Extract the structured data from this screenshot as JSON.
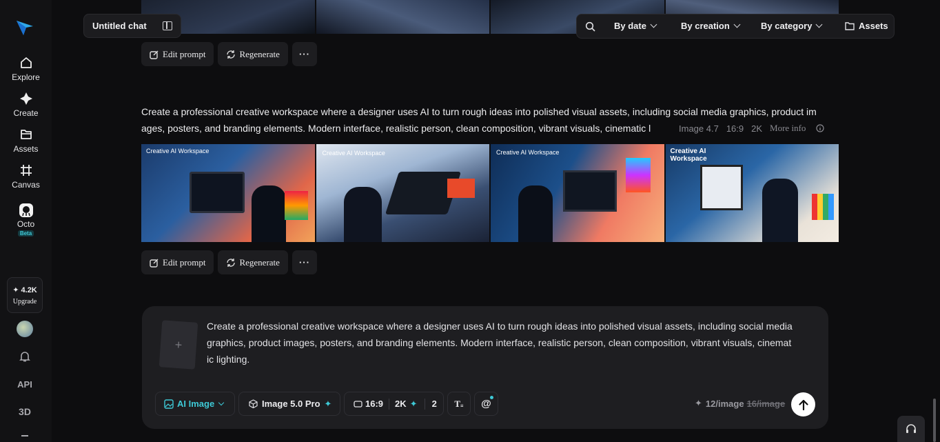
{
  "sidebar": {
    "items": [
      {
        "label": "Explore",
        "icon": "home-icon"
      },
      {
        "label": "Create",
        "icon": "sparkle-icon"
      },
      {
        "label": "Assets",
        "icon": "folder-icon"
      },
      {
        "label": "Canvas",
        "icon": "canvas-icon"
      },
      {
        "label": "Octo",
        "icon": "octo-icon",
        "badge": "Beta"
      }
    ],
    "credits": "4.2K",
    "upgrade_label": "Upgrade",
    "api_label": "API",
    "three_d_label": "3D"
  },
  "chat": {
    "title": "Untitled chat"
  },
  "filters": {
    "by_date": "By date",
    "by_creation": "By creation",
    "by_category": "By category",
    "assets": "Assets"
  },
  "actions": {
    "edit_prompt": "Edit prompt",
    "regenerate": "Regenerate"
  },
  "generation": {
    "prompt_line1": "Create a professional creative workspace where a designer uses AI to turn rough ideas into polished visual assets, including social media graphics, product im",
    "prompt_line2": "ages, posters, and branding elements. Modern interface, realistic person, clean composition, vibrant visuals, cinematic l",
    "model": "Image 4.7",
    "ratio": "16:9",
    "resolution": "2K",
    "more_info": "More info",
    "image_captions": [
      "Creative AI Workspace",
      "Creative AI Workspace",
      "Creative AI Workspace",
      "Creative AI Workspace"
    ]
  },
  "composer": {
    "line1": "Create a professional creative workspace where a designer uses AI to turn rough ideas into polished visual assets, including social media",
    "line2": "graphics, product images, posters, and branding elements.  Modern interface, realistic person, clean composition, vibrant visuals, cinemat",
    "line3": "ic lighting.",
    "mode": "AI Image",
    "model": "Image 5.0 Pro",
    "ratio": "16:9",
    "resolution": "2K",
    "count": "2",
    "cost": "12/image",
    "old_cost": "16/image"
  },
  "colors": {
    "accent": "#3ec9d6",
    "background": "#0d0d0f",
    "panel": "#1e1e21"
  }
}
